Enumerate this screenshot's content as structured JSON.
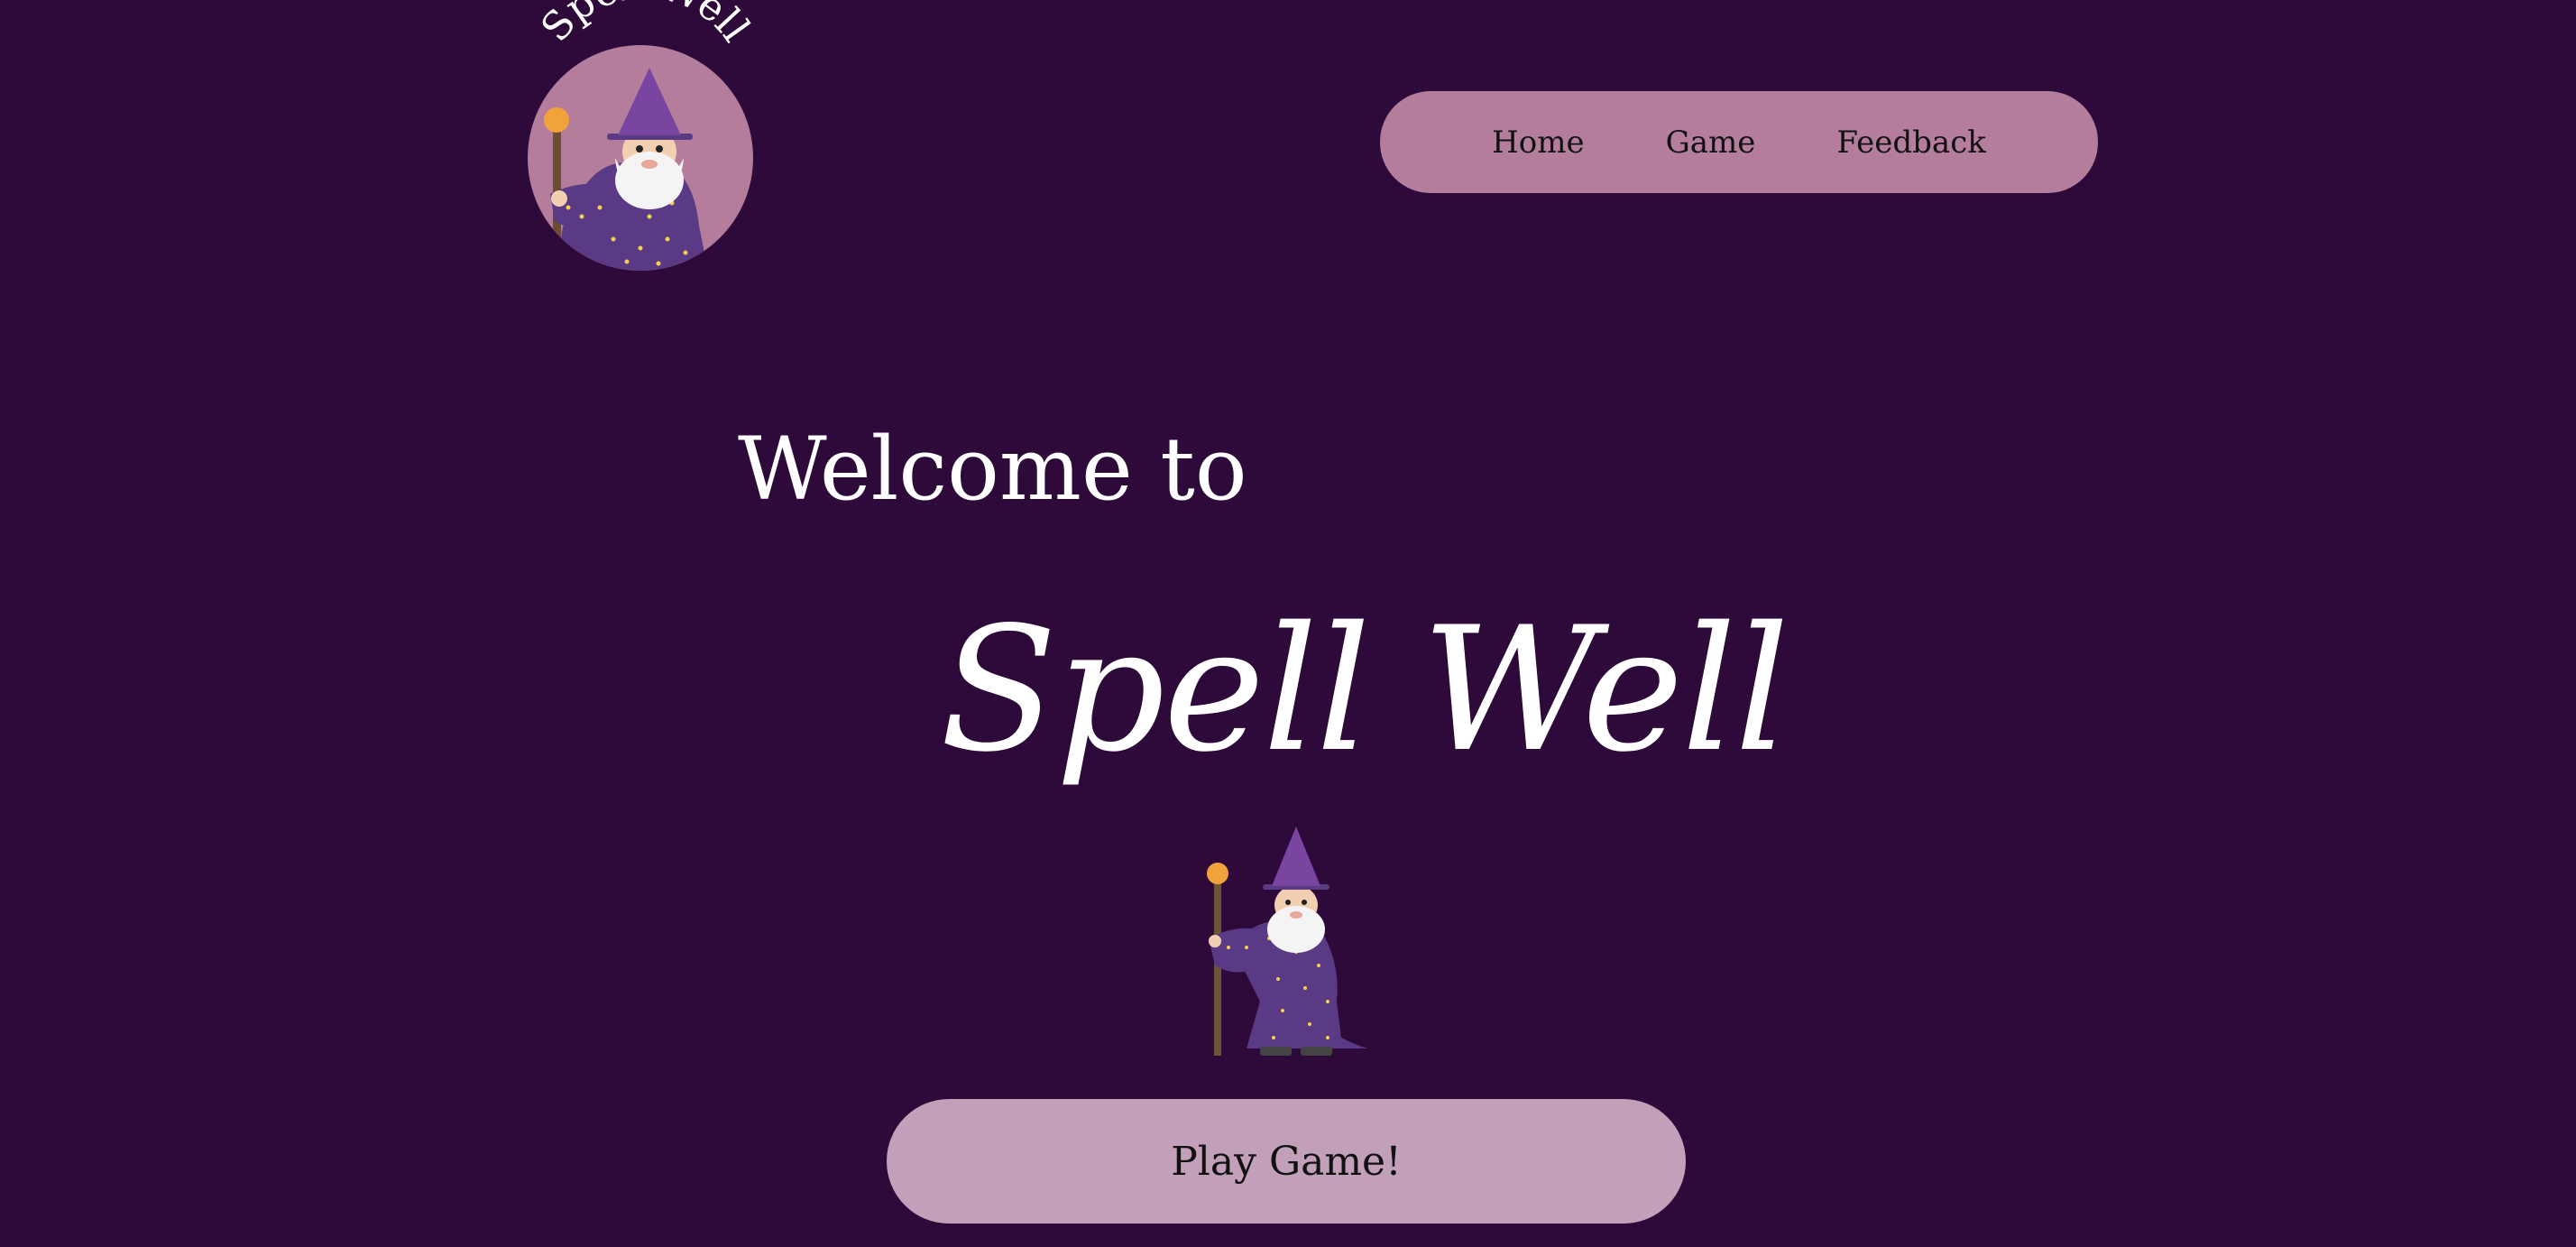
{
  "logo": {
    "text": "Spell Well",
    "icon": "wizard-logo-icon"
  },
  "nav": {
    "items": [
      {
        "label": "Home"
      },
      {
        "label": "Game"
      },
      {
        "label": "Feedback"
      }
    ]
  },
  "hero": {
    "welcome": "Welcome to",
    "title": "Spell Well",
    "icon": "wizard-icon",
    "play_label": "Play Game!"
  },
  "colors": {
    "background": "#2d0a3a",
    "nav_bg": "#b47d9b",
    "button_bg": "#c3a0b9",
    "text_light": "#ffffff",
    "wizard_robe": "#5b3a85",
    "wizard_hat": "#7a45a0",
    "staff_orb": "#f2a23a"
  }
}
